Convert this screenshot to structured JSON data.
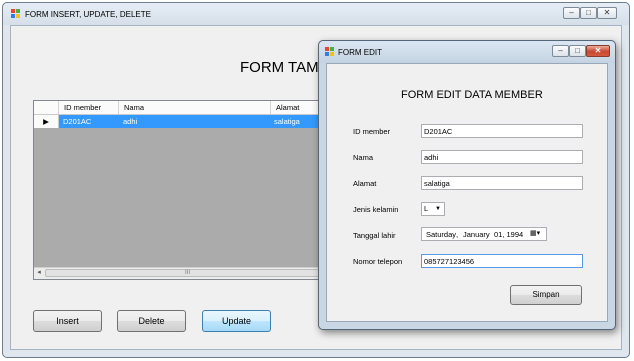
{
  "main_window": {
    "title": "FORM INSERT, UPDATE, DELETE",
    "heading": "FORM TAMI",
    "columns": [
      "ID member",
      "Nama",
      "Alamat"
    ],
    "rows": [
      {
        "id_member": "D201AC",
        "nama": "adhi",
        "alamat": "salatiga"
      }
    ],
    "scroll_thumb": "III",
    "buttons": {
      "insert": "Insert",
      "delete": "Delete",
      "update": "Update"
    },
    "controls": {
      "minimize": "–",
      "maximize": "□",
      "close": "✕"
    }
  },
  "edit_window": {
    "title": "FORM EDIT",
    "heading": "FORM EDIT DATA MEMBER",
    "fields": {
      "id_member": {
        "label": "ID member",
        "value": "D201AC"
      },
      "nama": {
        "label": "Nama",
        "value": "adhi"
      },
      "alamat": {
        "label": "Alamat",
        "value": "salatiga"
      },
      "jenis_kelamin": {
        "label": "Jenis kelamin",
        "value": "L"
      },
      "tanggal_lahir": {
        "label": "Tanggal lahir",
        "day": "Saturday",
        "sep1": ",",
        "month": "January",
        "date": "01, 1994"
      },
      "nomor_telepon": {
        "label": "Nomor telepon",
        "value": "085727123456"
      }
    },
    "simpan_label": "Simpan",
    "controls": {
      "minimize": "–",
      "maximize": "□",
      "close": "✕"
    }
  },
  "colors": {
    "selection": "#3399ff",
    "grid_bg": "#ababab",
    "window_bg": "#f0f0f0"
  }
}
